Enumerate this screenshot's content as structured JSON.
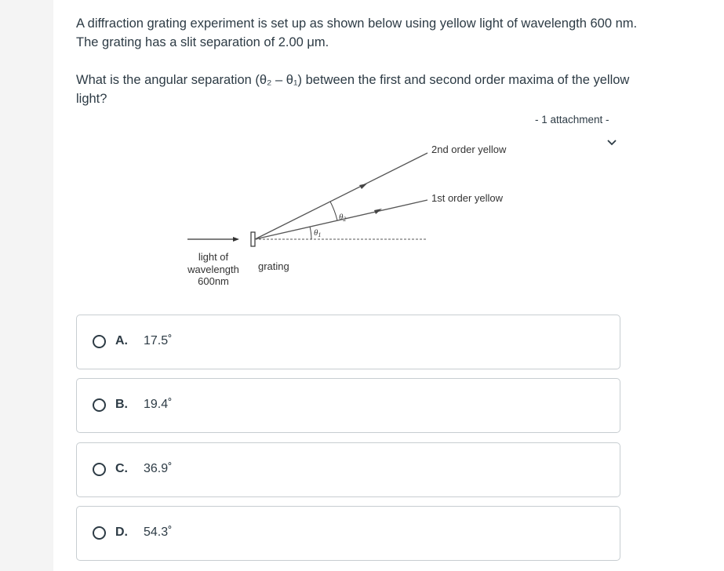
{
  "question": {
    "stem_line1": "A diffraction grating experiment is set up as shown below using yellow light of wavelength 600 nm. The grating has a slit separation of 2.00 μm.",
    "stem_line2": "What is the angular separation (θ₂ – θ₁) between the first and second order maxima of the yellow light?"
  },
  "attachment": {
    "label": "- 1 attachment -",
    "icon": "chevron-down-icon"
  },
  "diagram": {
    "label_2nd": "2nd order yellow",
    "label_1st": "1st order yellow",
    "theta1": "θ",
    "theta1_sub": "1",
    "theta2": "θ",
    "theta2_sub": "2",
    "light_line1": "light of",
    "light_line2": "wavelength",
    "light_line3": "600nm",
    "grating": "grating"
  },
  "options": [
    {
      "letter": "A.",
      "value": "17.5˚"
    },
    {
      "letter": "B.",
      "value": "19.4˚"
    },
    {
      "letter": "C.",
      "value": "36.9˚"
    },
    {
      "letter": "D.",
      "value": "54.3˚"
    }
  ]
}
